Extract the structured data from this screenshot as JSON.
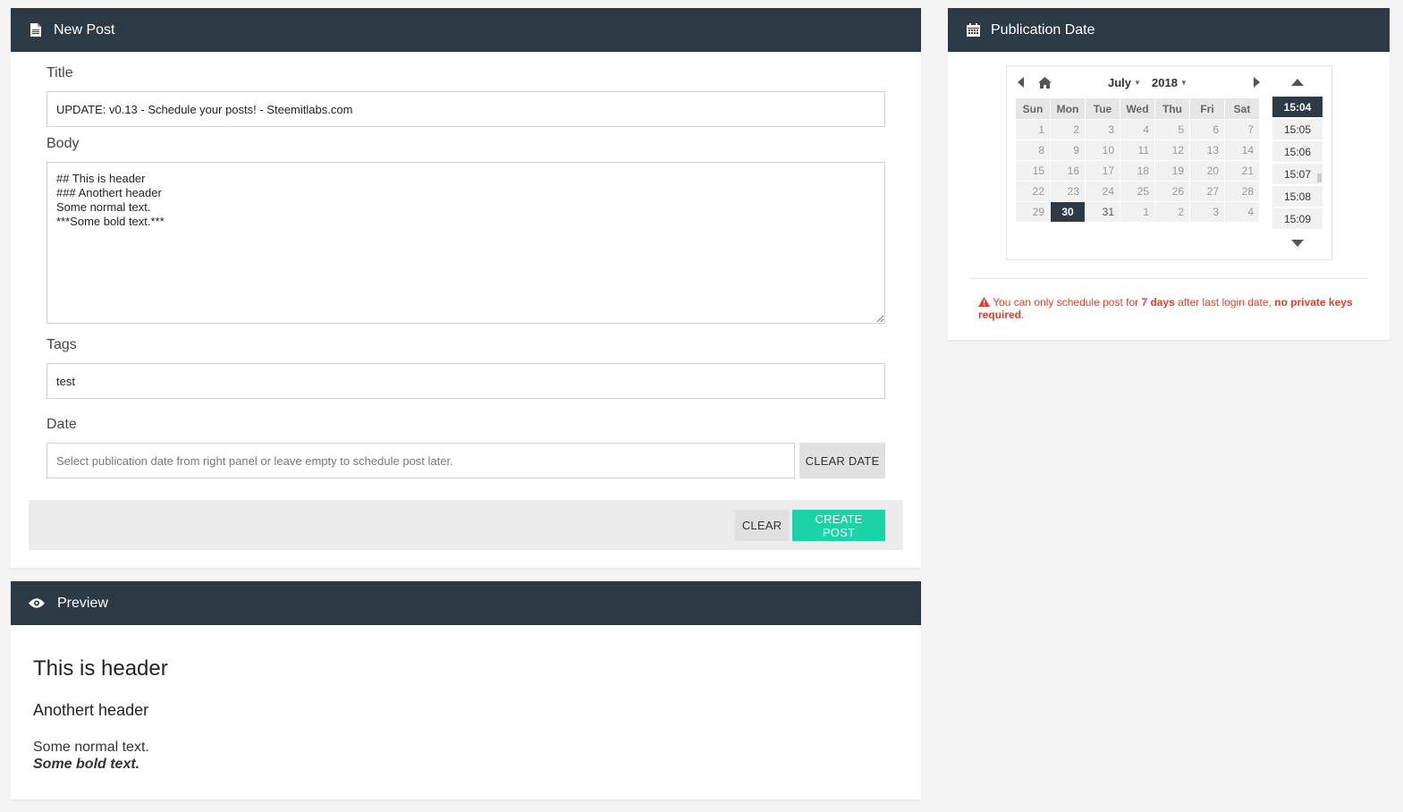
{
  "new_post": {
    "title": "New Post",
    "icon": "file-icon",
    "title_label": "Title",
    "title_value": "UPDATE: v0.13 - Schedule your posts! - Steemitlabs.com",
    "body_label": "Body",
    "body_value": "## This is header\n### Anothert header\nSome normal text.\n***Some bold text.***",
    "tags_label": "Tags",
    "tags_value": "test",
    "date_label": "Date",
    "date_placeholder": "Select publication date from right panel or leave empty to schedule post later.",
    "clear_date_label": "CLEAR DATE",
    "clear_label": "CLEAR",
    "create_label": "CREATE POST"
  },
  "publication": {
    "title": "Publication Date",
    "icon": "calendar-icon",
    "month": "July",
    "year": "2018",
    "weekdays": [
      "Sun",
      "Mon",
      "Tue",
      "Wed",
      "Thu",
      "Fri",
      "Sat"
    ],
    "weeks": [
      [
        "1",
        "2",
        "3",
        "4",
        "5",
        "6",
        "7"
      ],
      [
        "8",
        "9",
        "10",
        "11",
        "12",
        "13",
        "14"
      ],
      [
        "15",
        "16",
        "17",
        "18",
        "19",
        "20",
        "21"
      ],
      [
        "22",
        "23",
        "24",
        "25",
        "26",
        "27",
        "28"
      ],
      [
        "29",
        "30",
        "31",
        "1",
        "2",
        "3",
        "4"
      ]
    ],
    "selected_day": "30",
    "times": [
      "15:04",
      "15:05",
      "15:06",
      "15:07",
      "15:08",
      "15:09"
    ],
    "selected_time": "15:04",
    "warning_pre": "You can only schedule post for ",
    "warning_days": "7 days",
    "warning_mid": " after last login date, ",
    "warning_keys": "no private keys required",
    "warning_end": "."
  },
  "preview": {
    "title": "Preview",
    "icon": "eye-icon",
    "h1": "This is header",
    "h2": "Anothert header",
    "normal": "Some normal text.",
    "bold": "Some bold text."
  },
  "colors": {
    "header_bg": "#2c3a46",
    "accent": "#1ad3a6",
    "warning": "#e2402c"
  }
}
